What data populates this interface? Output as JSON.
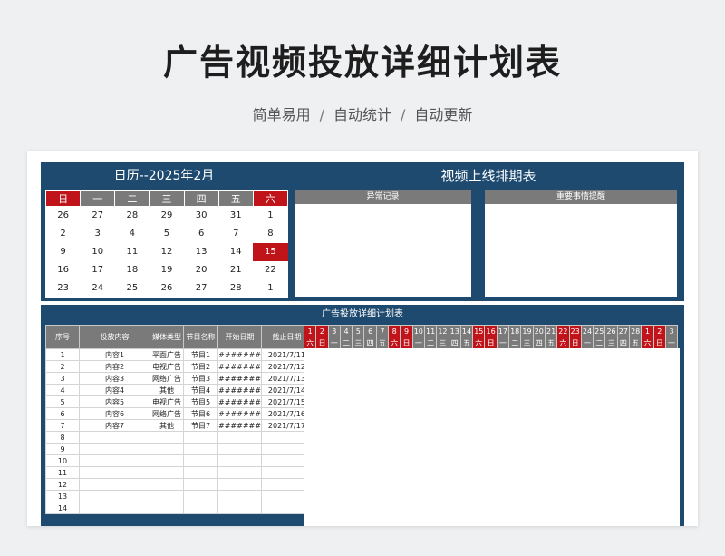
{
  "page": {
    "title": "广告视频投放详细计划表",
    "subtitle": [
      "简单易用",
      "自动统计",
      "自动更新"
    ],
    "separator": "/"
  },
  "calendar": {
    "title": "日历--2025年2月",
    "weekdays": [
      "日",
      "一",
      "二",
      "三",
      "四",
      "五",
      "六"
    ],
    "weeks": [
      [
        "26",
        "27",
        "28",
        "29",
        "30",
        "31",
        "1"
      ],
      [
        "2",
        "3",
        "4",
        "5",
        "6",
        "7",
        "8"
      ],
      [
        "9",
        "10",
        "11",
        "12",
        "13",
        "14",
        "15"
      ],
      [
        "16",
        "17",
        "18",
        "19",
        "20",
        "21",
        "22"
      ],
      [
        "23",
        "24",
        "25",
        "26",
        "27",
        "28",
        "1"
      ]
    ],
    "today": "15"
  },
  "schedule": {
    "title": "视频上线排期表",
    "abnormal_label": "异常记录",
    "important_label": "重要事情提醒"
  },
  "plan": {
    "title": "广告投放详细计划表",
    "headers": [
      "序号",
      "投放内容",
      "媒体类型",
      "节目名称",
      "开始日期",
      "截止日期"
    ],
    "rows": [
      [
        "1",
        "内容1",
        "平面广告",
        "节目1",
        "#######",
        "2021/7/11"
      ],
      [
        "2",
        "内容2",
        "电视广告",
        "节目2",
        "#######",
        "2021/7/12"
      ],
      [
        "3",
        "内容3",
        "网络广告",
        "节目3",
        "#######",
        "2021/7/13"
      ],
      [
        "4",
        "内容4",
        "其他",
        "节目4",
        "#######",
        "2021/7/14"
      ],
      [
        "5",
        "内容5",
        "电视广告",
        "节目5",
        "#######",
        "2021/7/15"
      ],
      [
        "6",
        "内容6",
        "网络广告",
        "节目6",
        "#######",
        "2021/7/16"
      ],
      [
        "7",
        "内容7",
        "其他",
        "节目7",
        "#######",
        "2021/7/17"
      ],
      [
        "8",
        "",
        "",
        "",
        "",
        ""
      ],
      [
        "9",
        "",
        "",
        "",
        "",
        ""
      ],
      [
        "10",
        "",
        "",
        "",
        "",
        ""
      ],
      [
        "11",
        "",
        "",
        "",
        "",
        ""
      ],
      [
        "12",
        "",
        "",
        "",
        "",
        ""
      ],
      [
        "13",
        "",
        "",
        "",
        "",
        ""
      ],
      [
        "14",
        "",
        "",
        "",
        "",
        ""
      ]
    ]
  },
  "gantt": {
    "days": [
      "1",
      "2",
      "3",
      "4",
      "5",
      "6",
      "7",
      "8",
      "9",
      "10",
      "11",
      "12",
      "13",
      "14",
      "15",
      "16",
      "17",
      "18",
      "19",
      "20",
      "21",
      "22",
      "23",
      "24",
      "25",
      "26",
      "27",
      "28",
      "1",
      "2",
      "3"
    ],
    "weekdays": [
      "六",
      "日",
      "一",
      "二",
      "三",
      "四",
      "五",
      "六",
      "日",
      "一",
      "二",
      "三",
      "四",
      "五",
      "六",
      "日",
      "一",
      "二",
      "三",
      "四",
      "五",
      "六",
      "日",
      "一",
      "二",
      "三",
      "四",
      "五",
      "六",
      "日",
      "一"
    ]
  },
  "colors": {
    "navy": "#1e4a70",
    "weekend_red": "#c0141a",
    "header_gray": "#7a7a7a"
  }
}
